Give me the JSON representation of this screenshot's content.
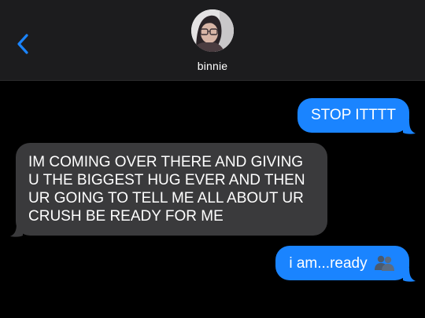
{
  "header": {
    "contact_name": "binnie",
    "avatar_icon": "contact-avatar-photo",
    "back_icon": "chevron-left-icon",
    "accent_color": "#1a84ff"
  },
  "messages": [
    {
      "direction": "sent",
      "text": "STOP ITTTT"
    },
    {
      "direction": "received",
      "text": "IM COMING OVER THERE AND GIVING U THE BIGGEST HUG EVER AND THEN UR GOING TO TELL ME ALL ABOUT UR CRUSH BE READY FOR ME"
    },
    {
      "direction": "sent",
      "text": "i am...ready",
      "emoji": "people-silhouette-emoji"
    }
  ],
  "colors": {
    "sent_bubble": "#1a84ff",
    "received_bubble": "#3a3a3c",
    "background": "#000000",
    "header": "#1c1c1e"
  }
}
